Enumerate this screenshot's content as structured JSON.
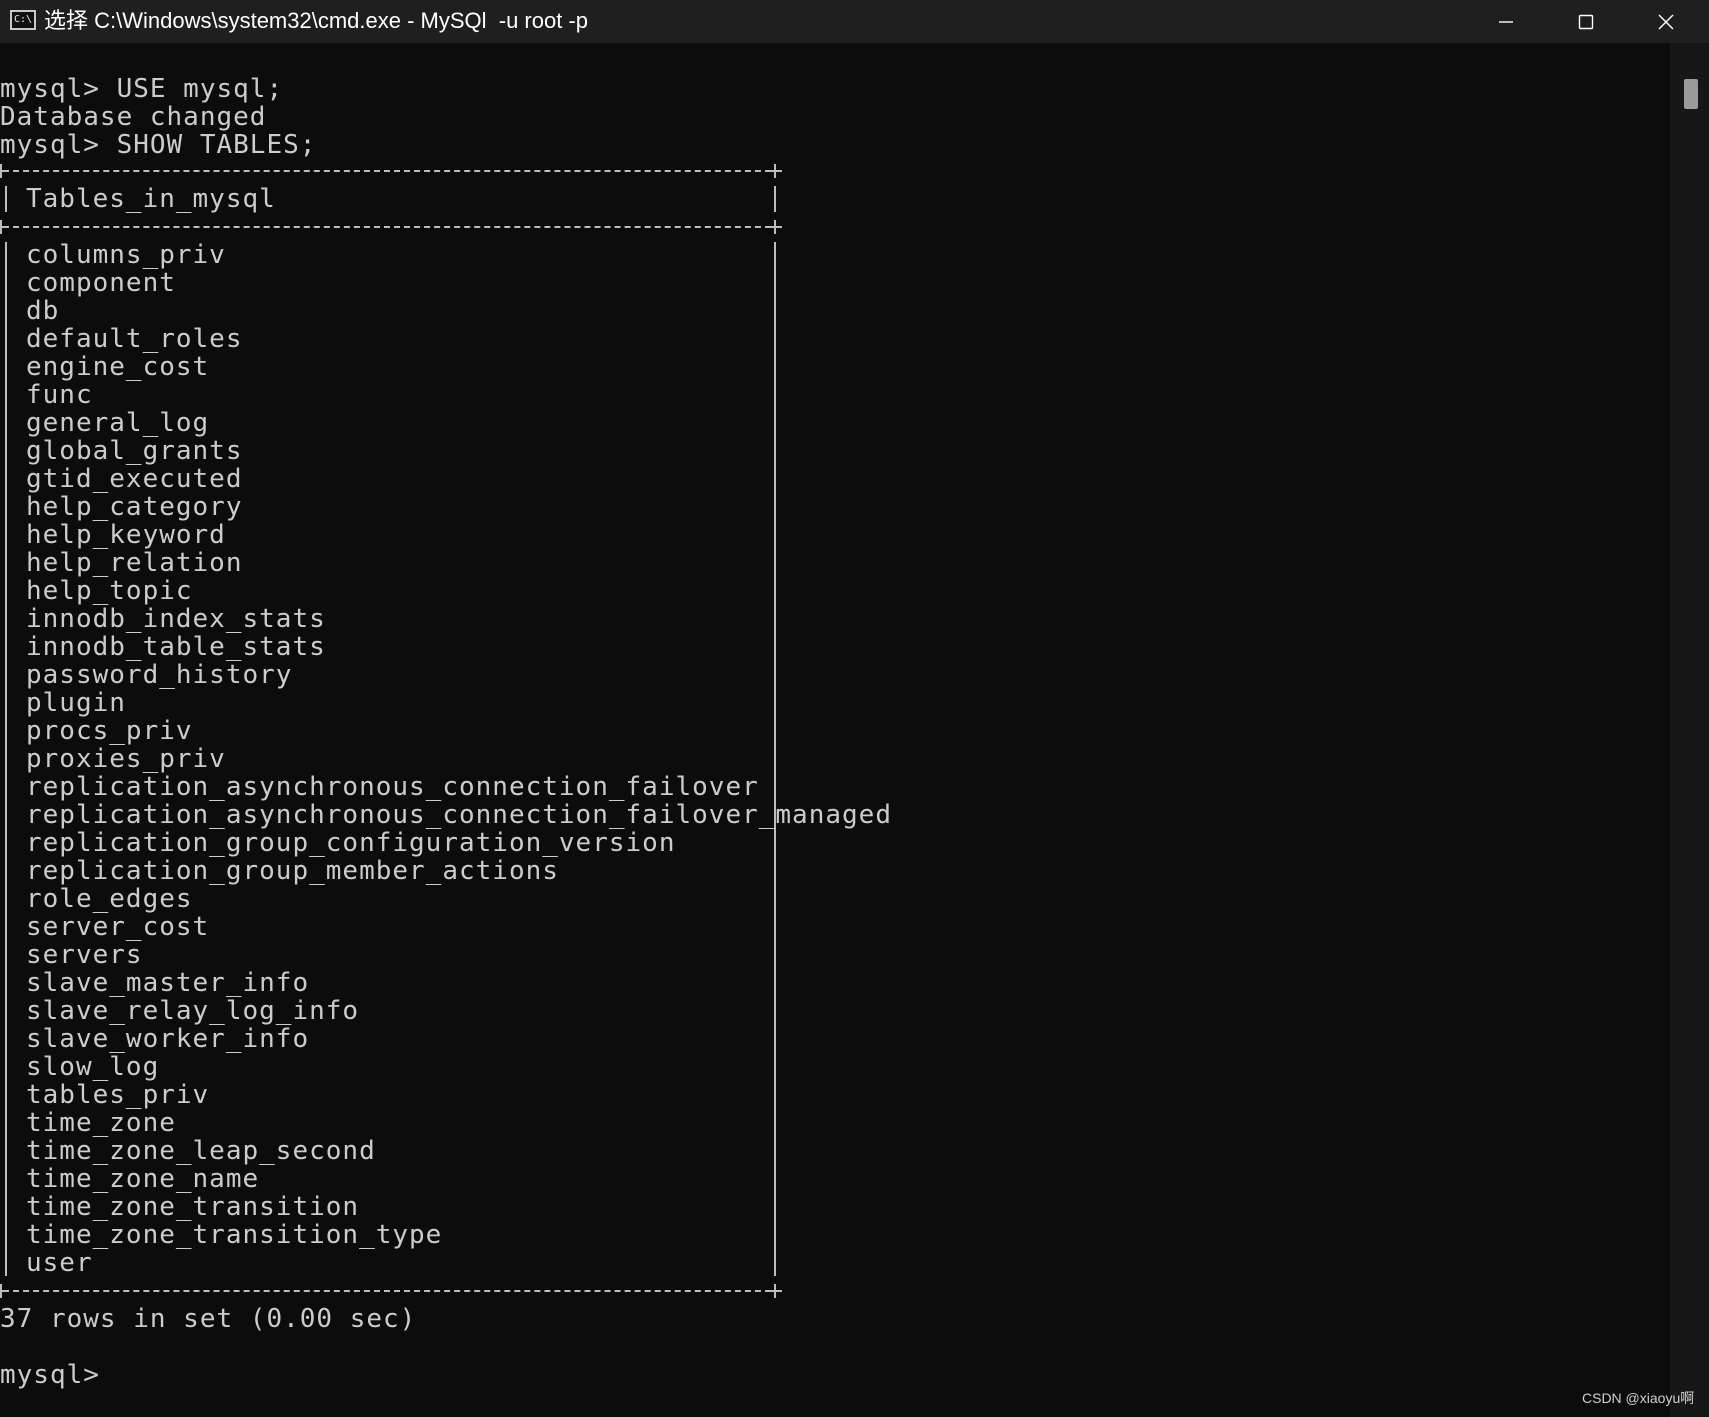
{
  "window": {
    "title": "选择 C:\\Windows\\system32\\cmd.exe - MySQl  -u root -p",
    "app_icon_text": "C:\\.",
    "controls": {
      "minimize": "minimize-icon",
      "maximize": "maximize-icon",
      "close": "close-icon"
    }
  },
  "console": {
    "prompt_lines": [
      "mysql> USE mysql;",
      "Database changed",
      "mysql> SHOW TABLES;"
    ],
    "table": {
      "header": "Tables_in_mysql",
      "rows": [
        "columns_priv",
        "component",
        "db",
        "default_roles",
        "engine_cost",
        "func",
        "general_log",
        "global_grants",
        "gtid_executed",
        "help_category",
        "help_keyword",
        "help_relation",
        "help_topic",
        "innodb_index_stats",
        "innodb_table_stats",
        "password_history",
        "plugin",
        "procs_priv",
        "proxies_priv",
        "replication_asynchronous_connection_failover",
        "replication_asynchronous_connection_failover_managed",
        "replication_group_configuration_version",
        "replication_group_member_actions",
        "role_edges",
        "server_cost",
        "servers",
        "slave_master_info",
        "slave_relay_log_info",
        "slave_worker_info",
        "slow_log",
        "tables_priv",
        "time_zone",
        "time_zone_leap_second",
        "time_zone_name",
        "time_zone_transition",
        "time_zone_transition_type",
        "user"
      ]
    },
    "summary": "37 rows in set (0.00 sec)",
    "final_prompt": "mysql>"
  },
  "watermark": "CSDN @xiaoyu啊",
  "colors": {
    "background": "#0c0c0c",
    "titlebar": "#1f1f1f",
    "text": "#cccccc"
  }
}
